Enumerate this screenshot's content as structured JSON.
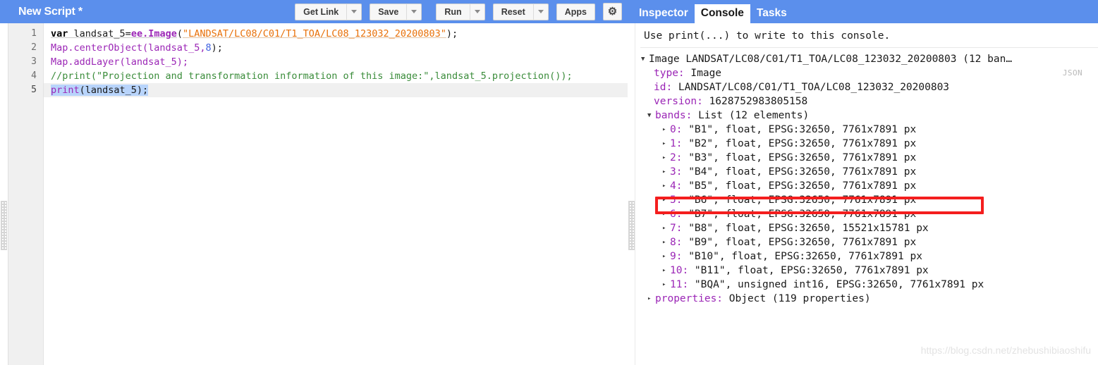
{
  "editor": {
    "title": "New Script *",
    "toolbar": {
      "get_link": "Get Link",
      "save": "Save",
      "run": "Run",
      "reset": "Reset",
      "apps": "Apps",
      "settings_icon": "gear-icon",
      "caret_icon": "chevron-down-icon"
    },
    "line_numbers": [
      "1",
      "2",
      "3",
      "4",
      "5"
    ],
    "code": {
      "line1": {
        "kw": "var",
        "space": " ",
        "varname": "landsat_5=",
        "ns": "ee.Image",
        "paren_open": "(",
        "string": "\"LANDSAT/LC08/C01/T1_TOA/LC08_123032_20200803\"",
        "tail": ");"
      },
      "line2": {
        "text": "Map.centerObject(landsat_5,",
        "num": "8",
        "tail": ");"
      },
      "line3": {
        "text": "Map.addLayer(landsat_5);"
      },
      "line4": {
        "comment": "//print(\"Projection and transformation information of this image:\",landsat_5.projection());"
      },
      "line5": {
        "fn": "print",
        "rest": "(landsat_5);"
      }
    }
  },
  "console": {
    "tabs": [
      {
        "label": "Inspector",
        "active": false
      },
      {
        "label": "Console",
        "active": true
      },
      {
        "label": "Tasks",
        "active": false
      }
    ],
    "hint": "Use print(...) to write to this console.",
    "json_link": "JSON",
    "root": {
      "toggle": "▼",
      "label": "Image LANDSAT/LC08/C01/T1_TOA/LC08_123032_20200803 (12 ban…"
    },
    "props": [
      {
        "key": "type:",
        "value": " Image"
      },
      {
        "key": "id:",
        "value": " LANDSAT/LC08/C01/T1_TOA/LC08_123032_20200803"
      },
      {
        "key": "version:",
        "value": " 1628752983805158"
      }
    ],
    "bands_node": {
      "toggle": "▼",
      "key": "bands:",
      "value": " List (12 elements)"
    },
    "bands": [
      {
        "toggle": "▸",
        "index": "0:",
        "value": " \"B1\", float, EPSG:32650, 7761x7891 px"
      },
      {
        "toggle": "▸",
        "index": "1:",
        "value": " \"B2\", float, EPSG:32650, 7761x7891 px"
      },
      {
        "toggle": "▸",
        "index": "2:",
        "value": " \"B3\", float, EPSG:32650, 7761x7891 px"
      },
      {
        "toggle": "▸",
        "index": "3:",
        "value": " \"B4\", float, EPSG:32650, 7761x7891 px"
      },
      {
        "toggle": "▸",
        "index": "4:",
        "value": " \"B5\", float, EPSG:32650, 7761x7891 px"
      },
      {
        "toggle": "▸",
        "index": "5:",
        "value": " \"B6\", float, EPSG:32650, 7761x7891 px"
      },
      {
        "toggle": "▸",
        "index": "6:",
        "value": " \"B7\", float, EPSG:32650, 7761x7891 px"
      },
      {
        "toggle": "▸",
        "index": "7:",
        "value": " \"B8\", float, EPSG:32650, 15521x15781 px"
      },
      {
        "toggle": "▸",
        "index": "8:",
        "value": " \"B9\", float, EPSG:32650, 7761x7891 px"
      },
      {
        "toggle": "▸",
        "index": "9:",
        "value": " \"B10\", float, EPSG:32650, 7761x7891 px"
      },
      {
        "toggle": "▸",
        "index": "10:",
        "value": " \"B11\", float, EPSG:32650, 7761x7891 px"
      },
      {
        "toggle": "▸",
        "index": "11:",
        "value": " \"BQA\", unsigned int16, EPSG:32650, 7761x7891 px"
      }
    ],
    "properties_node": {
      "toggle": "▸",
      "key": "properties:",
      "value": " Object (119 properties)"
    },
    "highlight": {
      "target_index": "7",
      "color": "#f41e1e"
    }
  },
  "watermark": "https://blog.csdn.net/zhebushibiaoshifu",
  "colors": {
    "toolbar_blue": "#5b8fec",
    "highlight_red": "#f41e1e",
    "selection_blue": "#b8d4fb",
    "gutter_gray": "#f0f0f0"
  }
}
